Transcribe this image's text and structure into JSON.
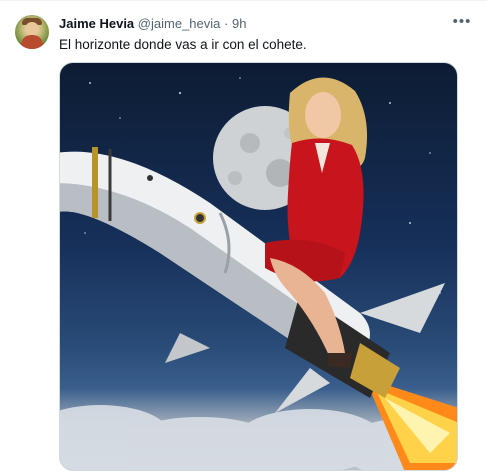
{
  "tweet": {
    "author_name": "Jaime Hevia",
    "author_handle": "@jaime_hevia",
    "separator": "·",
    "timestamp": "9h",
    "text": "El horizonte donde vas a ir con el cohete.",
    "more_icon": "more-horizontal-icon",
    "avatar_icon": "avatar-image"
  },
  "colors": {
    "text_primary": "#0f1419",
    "text_secondary": "#536471",
    "border": "#cfd9de"
  }
}
